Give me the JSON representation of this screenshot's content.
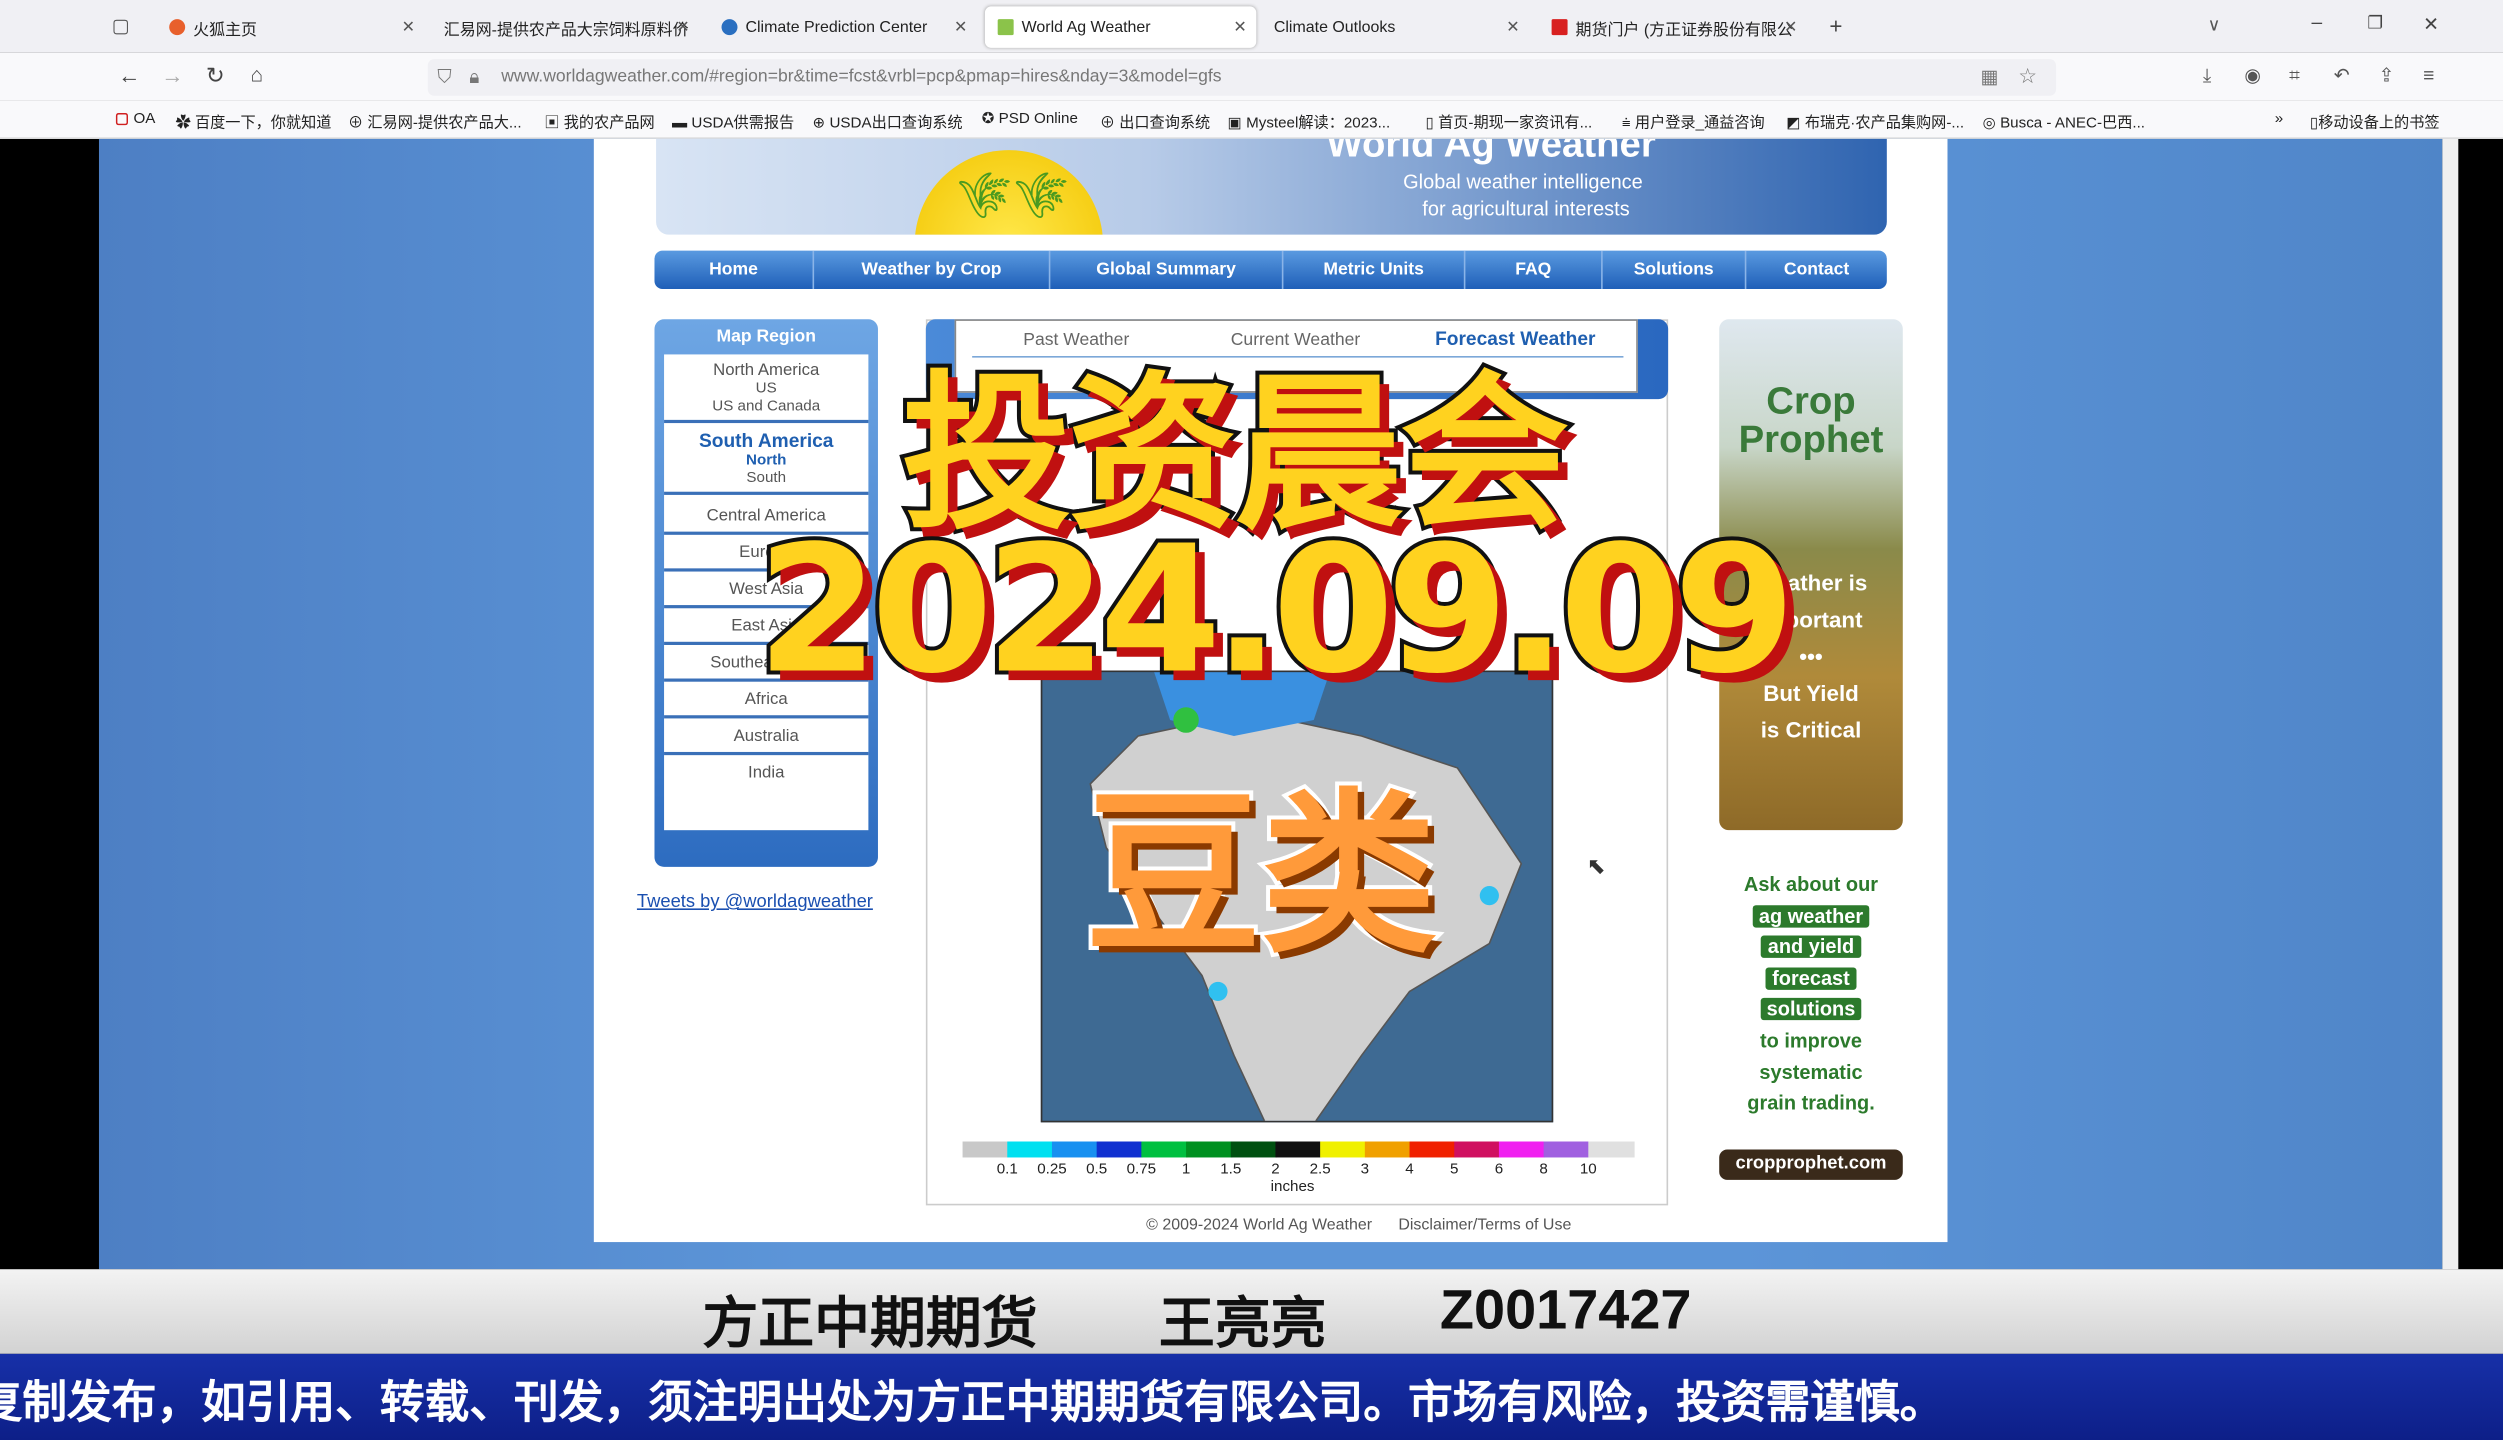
{
  "browser": {
    "tabs": [
      {
        "label": "火狐主页",
        "active": false
      },
      {
        "label": "汇易网-提供农产品大宗饲料原料价",
        "active": false
      },
      {
        "label": "Climate Prediction Center",
        "active": false
      },
      {
        "label": "World Ag Weather",
        "active": true
      },
      {
        "label": "Climate Outlooks",
        "active": false
      },
      {
        "label": "期货门户 (方正证券股份有限公",
        "active": false
      }
    ],
    "url": "www.worldagweather.com/#region=br&time=fcst&vrbl=pcp&pmap=hires&nday=3&model=gfs",
    "bookmarks": [
      "OA",
      "百度一下，你就知道",
      "汇易网-提供农产品大...",
      "我的农产品网",
      "USDA供需报告",
      "USDA出口查询系统",
      "PSD Online",
      "出口查询系统",
      "Mysteel解读：2023...",
      "首页-期现一家资讯有...",
      "用户登录_通益咨询",
      "布瑞克·农产品集购网-...",
      "Busca - ANEC-巴西..."
    ],
    "mobile_bookmarks": "移动设备上的书签"
  },
  "site": {
    "title": "World Ag Weather",
    "tagline1": "Global weather intelligence",
    "tagline2": "for agricultural interests",
    "nav": [
      "Home",
      "Weather by Crop",
      "Global Summary",
      "Metric Units",
      "FAQ",
      "Solutions",
      "Contact"
    ],
    "sidebar": {
      "header": "Map Region",
      "items": [
        {
          "label": "North America",
          "sub": [
            "US",
            "US and Canada"
          ]
        },
        {
          "label": "South America",
          "sub": [
            "North",
            "South"
          ],
          "selected": true
        },
        {
          "label": "Central America"
        },
        {
          "label": "Europe"
        },
        {
          "label": "West Asia"
        },
        {
          "label": "East Asia"
        },
        {
          "label": "Southeast Asia"
        },
        {
          "label": "Africa"
        },
        {
          "label": "Australia"
        },
        {
          "label": "India"
        }
      ]
    },
    "tweets_link": "Tweets by @worldagweather",
    "time_tabs": [
      "Past Weather",
      "Current Weather",
      "Forecast Weather"
    ],
    "active_time_tab": "Forecast Weather",
    "colorbar": {
      "labels": [
        "0.1",
        "0.25",
        "0.5",
        "0.75",
        "1",
        "1.5",
        "2",
        "2.5",
        "3",
        "4",
        "5",
        "6",
        "8",
        "10"
      ],
      "unit": "inches",
      "colors": [
        "#c8c8c8",
        "#00e0f0",
        "#1890f0",
        "#1030d0",
        "#00c040",
        "#009020",
        "#005010",
        "#101010",
        "#f0f000",
        "#f0a000",
        "#f02000",
        "#d01060",
        "#f020f0",
        "#a060e0",
        "#e0e0e0"
      ]
    },
    "footer_copyright": "© 2009-2024 World Ag Weather",
    "footer_link": "Disclaimer/Terms of Use",
    "ad1": {
      "brand": "Crop Prophet",
      "line1": "Weather is",
      "line2": "Important",
      "dots": "•••",
      "line3": "But Yield",
      "line4": "is Critical"
    },
    "ad2": {
      "lines": [
        "Ask about our",
        "ag weather",
        "and yield",
        "forecast",
        "solutions",
        "to improve",
        "systematic",
        "grain trading."
      ],
      "url": "cropprophet.com"
    }
  },
  "overlay": {
    "title": "投资晨会",
    "date": "2024.09.09",
    "topic": "豆类"
  },
  "bottom": {
    "company": "方正中期期货",
    "analyst": "王亮亮",
    "license": "Z0017427",
    "ticker": "复制发布，如引用、转载、刊发，须注明出处为方正中期期货有限公司。市场有风险，投资需谨慎。"
  }
}
